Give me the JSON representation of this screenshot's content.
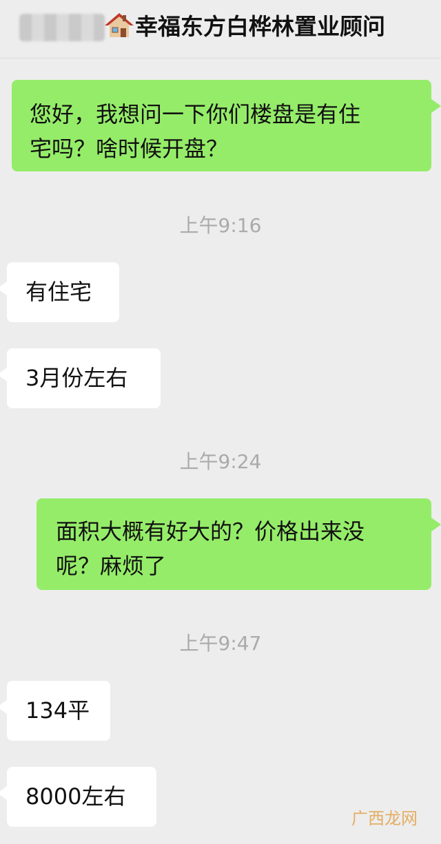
{
  "header": {
    "title": "幸福东方白桦林置业顾问",
    "icon": "house-icon"
  },
  "messages": [
    {
      "side": "right",
      "lines": [
        "您好，我想问一下你们楼盘是有住",
        "宅吗？啥时候开盘？"
      ]
    },
    {
      "time": "上午9:16"
    },
    {
      "side": "left",
      "text": "有住宅"
    },
    {
      "side": "left",
      "text": "3月份左右"
    },
    {
      "time": "上午9:24"
    },
    {
      "side": "right",
      "lines": [
        "面积大概有好大的？价格出来没",
        "呢？麻烦了"
      ]
    },
    {
      "time": "上午9:47"
    },
    {
      "side": "left",
      "text": "134平"
    },
    {
      "side": "left",
      "text": "8000左右"
    }
  ],
  "watermark": "广西龙网",
  "colors": {
    "background": "#ededed",
    "sent_bubble": "#95ec69",
    "received_bubble": "#ffffff",
    "timestamp": "#aaaaaa"
  }
}
